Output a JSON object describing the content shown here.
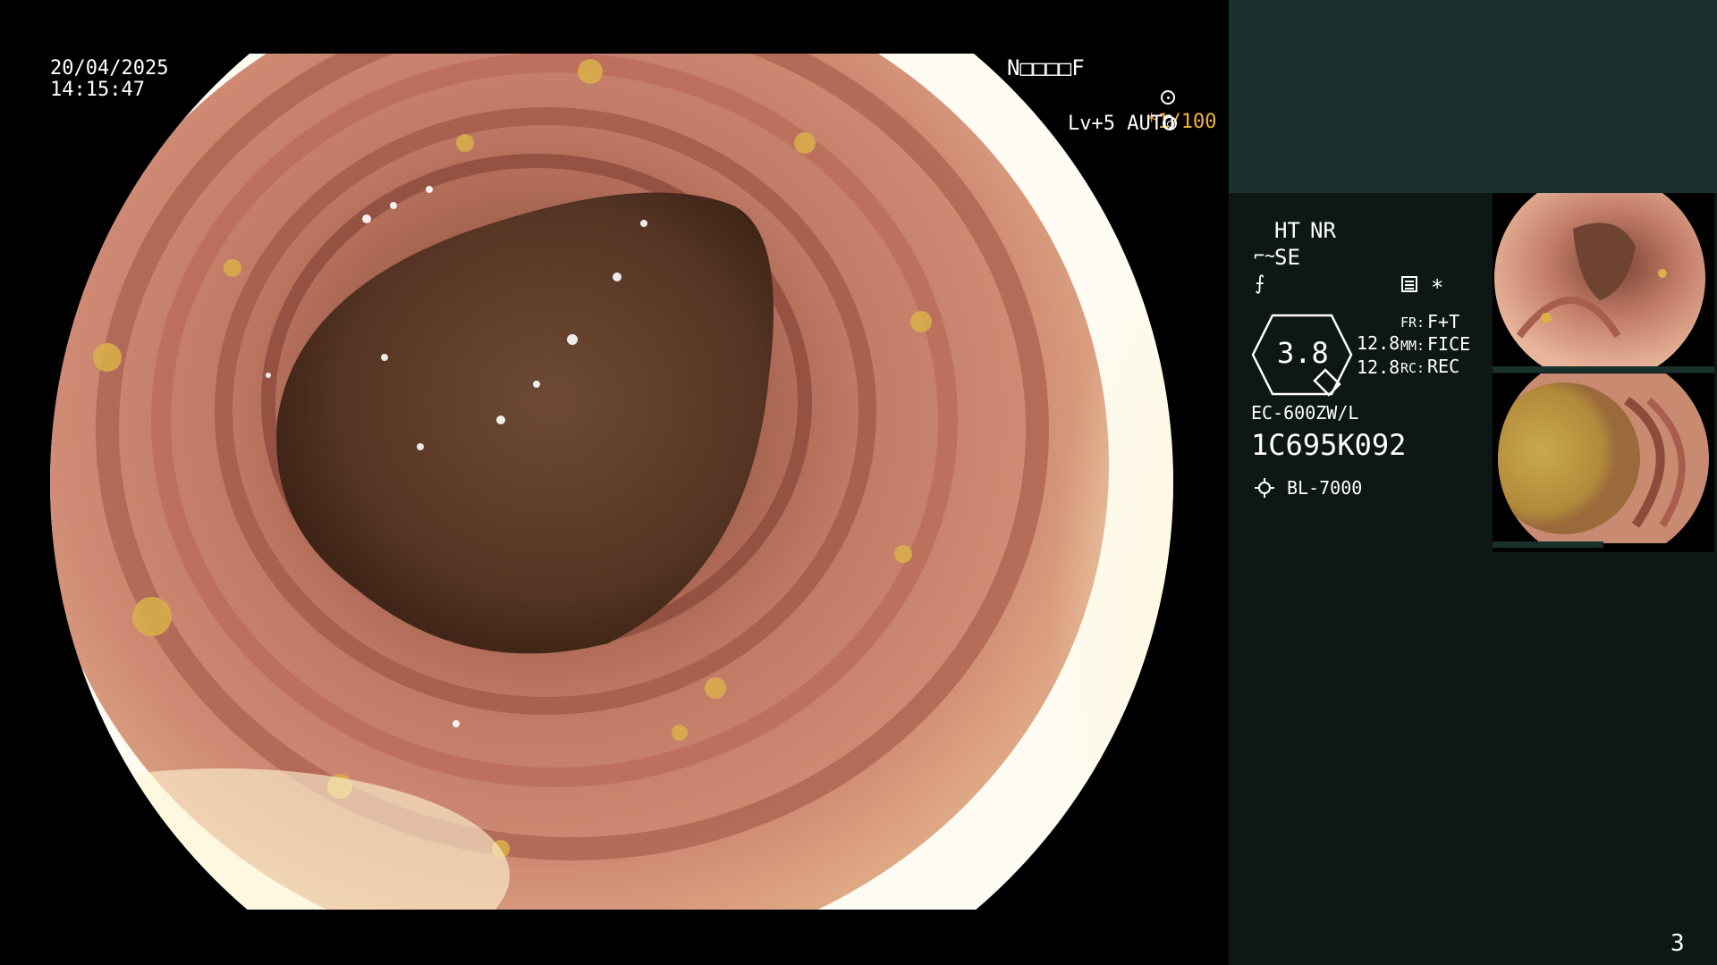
{
  "main": {
    "date": "20/04/2025",
    "time": "14:15:47",
    "patient_code": "N□□□□F",
    "shutter": "*1/100",
    "iris": "Lv+5 AUTO"
  },
  "panel": {
    "ht": "HT",
    "nr": "NR",
    "se": "SE",
    "asterisk": "*",
    "zoom": "3.8",
    "val1": "12.8",
    "val2": "12.8",
    "fr_label": "FR:",
    "fr_value": "F+T",
    "mm_label": "MM:",
    "mm_value": "FICE",
    "rc_label": "RC:",
    "rc_value": "REC",
    "scope_model": "EC-600ZW/L",
    "serial": "1C695K092",
    "light_source": "BL-7000",
    "page_number": "3"
  },
  "thumbnails": [
    {
      "name": "thumbnail-1"
    },
    {
      "name": "thumbnail-2"
    }
  ],
  "colors": {
    "panel_top": "#1a302d",
    "panel_body": "#0d1716",
    "accent_amber": "#f5b53d"
  }
}
